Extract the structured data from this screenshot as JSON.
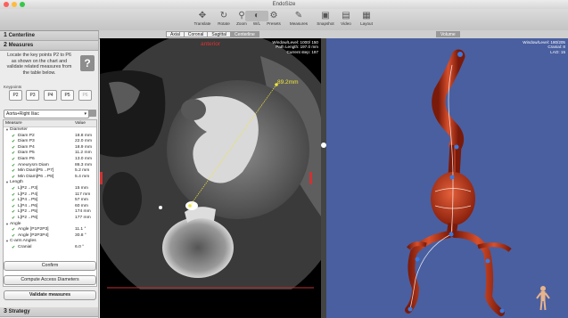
{
  "window": {
    "title": "EndoSize"
  },
  "toolbar": {
    "items": [
      {
        "label": "Translate",
        "icon": "translate-icon",
        "glyph": "✥"
      },
      {
        "label": "Rotate",
        "icon": "rotate-icon",
        "glyph": "↻"
      },
      {
        "label": "Zoom",
        "icon": "zoom-icon",
        "glyph": "⚲"
      },
      {
        "label": "W/L",
        "icon": "window-level-icon",
        "glyph": "◐"
      },
      {
        "label": "Presets",
        "icon": "presets-icon",
        "glyph": "⚙"
      },
      {
        "label": "Measures",
        "icon": "measures-icon",
        "glyph": "✎"
      },
      {
        "label": "Snapshot",
        "icon": "snapshot-icon",
        "glyph": "▣"
      },
      {
        "label": "Video",
        "icon": "video-icon",
        "glyph": "▤"
      },
      {
        "label": "Layout",
        "icon": "layout-icon",
        "glyph": "▦"
      }
    ]
  },
  "steps": {
    "centerline": {
      "num": "1",
      "label": "Centerline"
    },
    "measures": {
      "num": "2",
      "label": "Measures"
    },
    "strategy": {
      "num": "3",
      "label": "Strategy"
    }
  },
  "instructions": "Locate the key points P2 to P6 as shown on the chart and validate related measures from the table below.",
  "help_label": "?",
  "keypoints": {
    "label": "Keypoints",
    "items": [
      "P2",
      "P3",
      "P4",
      "P5",
      "P6"
    ]
  },
  "segment_select": {
    "value": "Aorta+Right Iliac"
  },
  "table": {
    "headers": {
      "measure": "Measure",
      "value": "Value"
    },
    "groups": [
      {
        "name": "Diameter",
        "rows": [
          {
            "name": "Diam P2",
            "value": "18.8 mm"
          },
          {
            "name": "Diam P3",
            "value": "22.0 mm"
          },
          {
            "name": "Diam P4",
            "value": "18.9 mm"
          },
          {
            "name": "Diam P5",
            "value": "11.2 mm"
          },
          {
            "name": "Diam P6",
            "value": "13.0 mm"
          },
          {
            "name": "Aneurysm Diam",
            "value": "86.3 mm"
          },
          {
            "name": "Min Diam[P5→P7]",
            "value": "5.2 mm"
          },
          {
            "name": "Min Diam[P6→P8]",
            "value": "5.4 mm"
          }
        ]
      },
      {
        "name": "Length",
        "rows": [
          {
            "name": "L[P2→P3]",
            "value": "15 mm"
          },
          {
            "name": "L[P2→P4]",
            "value": "117 mm"
          },
          {
            "name": "L[P4→P5]",
            "value": "57 mm"
          },
          {
            "name": "L[P4→P6]",
            "value": "60 mm"
          },
          {
            "name": "L[P2→P5]",
            "value": "174 mm"
          },
          {
            "name": "L[P2→P6]",
            "value": "177 mm"
          }
        ]
      },
      {
        "name": "Angle",
        "rows": [
          {
            "name": "Angle [P1P2P3]",
            "value": "11.1 °"
          },
          {
            "name": "Angle [P2P3P4]",
            "value": "30.8 °"
          }
        ]
      },
      {
        "name": "C-arm Angles",
        "rows": [
          {
            "name": "Cranial",
            "value": "6.0 °"
          }
        ]
      }
    ]
  },
  "buttons": {
    "confirm": "Confirm",
    "compute": "Compute Access Diameters",
    "validate": "Validate measures"
  },
  "view_tabs": [
    "Axial",
    "Coronal",
    "Sagittal",
    "Centerline"
  ],
  "volume_tab": "Volume",
  "ct_view": {
    "orientation": "anterior",
    "annotation": [
      "Window/Level: 1000/ 150",
      "Path Length: 197.0 mm",
      "Current step: 197"
    ],
    "measurement": "89.2mm"
  },
  "volume_view": {
    "annotation": [
      "Window/Level: 180/205",
      "Cranial: 8",
      "LAO: 15"
    ]
  },
  "colors": {
    "measure_line": "#f2e63a",
    "orientation_text": "#e03030",
    "volume_bg": "#4a5fa0",
    "vessel": "#c0391b"
  }
}
